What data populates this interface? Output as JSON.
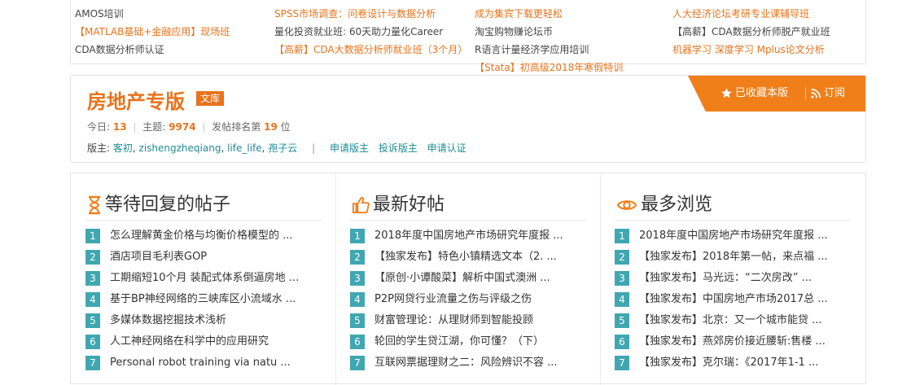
{
  "top_links": [
    [
      {
        "text": "AMOS培训",
        "style": "plain"
      },
      {
        "text": "【MATLAB基础+金融应用】现场班",
        "style": "orange"
      },
      {
        "text": "CDA数据分析师认证",
        "style": "plain"
      }
    ],
    [
      {
        "text": "SPSS市场调查：问卷设计与数据分析",
        "style": "orange"
      },
      {
        "text": "量化投资就业班: 60天助力量化Career",
        "style": "plain"
      },
      {
        "text": "【高薪】CDA大数据分析师就业班（3个月）",
        "style": "orange"
      }
    ],
    [
      {
        "text": "成为集宾下载更轻松",
        "style": "orange"
      },
      {
        "text": "淘宝购物赚论坛币",
        "style": "plain"
      },
      {
        "text": "R语言计量经济学应用培训",
        "style": "plain"
      },
      {
        "text": "【Stata】初高级2018年寒假特训",
        "style": "orange"
      }
    ],
    [
      {
        "text": "人大经济论坛考研专业课辅导班",
        "style": "orange"
      },
      {
        "text": "【高薪】CDA数据分析师脱产就业班",
        "style": "plain"
      },
      {
        "text": "机器学习  深度学习   Mplus论文分析",
        "style": "orange"
      }
    ]
  ],
  "forum": {
    "title": "房地产专版",
    "badge": "文库",
    "stats": {
      "today_label": "今日:",
      "today": "13",
      "topics_label": "主题:",
      "topics": "9974",
      "rank_label": "发帖排名第",
      "rank": "19",
      "rank_suffix": "位"
    },
    "mods_label": "版主:",
    "mods": [
      "客初",
      "zishengzheqiang",
      "life_life",
      "孢子云"
    ],
    "actions": [
      "申请版主",
      "投诉版主",
      "申请认证"
    ],
    "favorited_label": "已收藏本版",
    "subscribe_label": "订阅"
  },
  "columns": [
    {
      "title": "等待回复的帖子",
      "icon": "hourglass-icon",
      "items": [
        "怎么理解黄金价格与均衡价格模型的 ...",
        "酒店项目毛利表GOP",
        "工期缩短10个月 装配式体系倒逼房地 ...",
        "基于BP神经网络的三峡库区小流域水 ...",
        "多媒体数据挖掘技术浅析",
        "人工神经网络在科学中的应用研究",
        "Personal robot training via natu ..."
      ]
    },
    {
      "title": "最新好帖",
      "icon": "thumbs-up-icon",
      "items": [
        "2018年度中国房地产市场研究年度报 ...",
        "【独家发布】特色小镇精选文本（2. ...",
        "【原创·小谭酸菜】解析中国式澳洲 ...",
        "P2P网贷行业流量之伤与评级之伤",
        "财富管理论：从理财师到智能投顾",
        "轮回的学生贷江湖，你可懂？（下）",
        "互联网票据理财之二：风险辨识不容 ..."
      ]
    },
    {
      "title": "最多浏览",
      "icon": "eye-icon",
      "items": [
        "2018年度中国房地产市场研究年度报 ...",
        "【独家发布】2018年第一帖，来点福 ...",
        "【独家发布】马光远：“二次房改” ...",
        "【独家发布】中国房地产市场2017总 ...",
        "【独家发布】北京：又一个城市能贷 ...",
        "【独家发布】燕郊房价接近腰斩:售楼 ...",
        "【独家发布】克尔瑞：《2017年1-1 ..."
      ]
    }
  ],
  "colors": {
    "accent": "#e8731b",
    "teal": "#40a7b1",
    "ribbon": "#f07f1a"
  }
}
